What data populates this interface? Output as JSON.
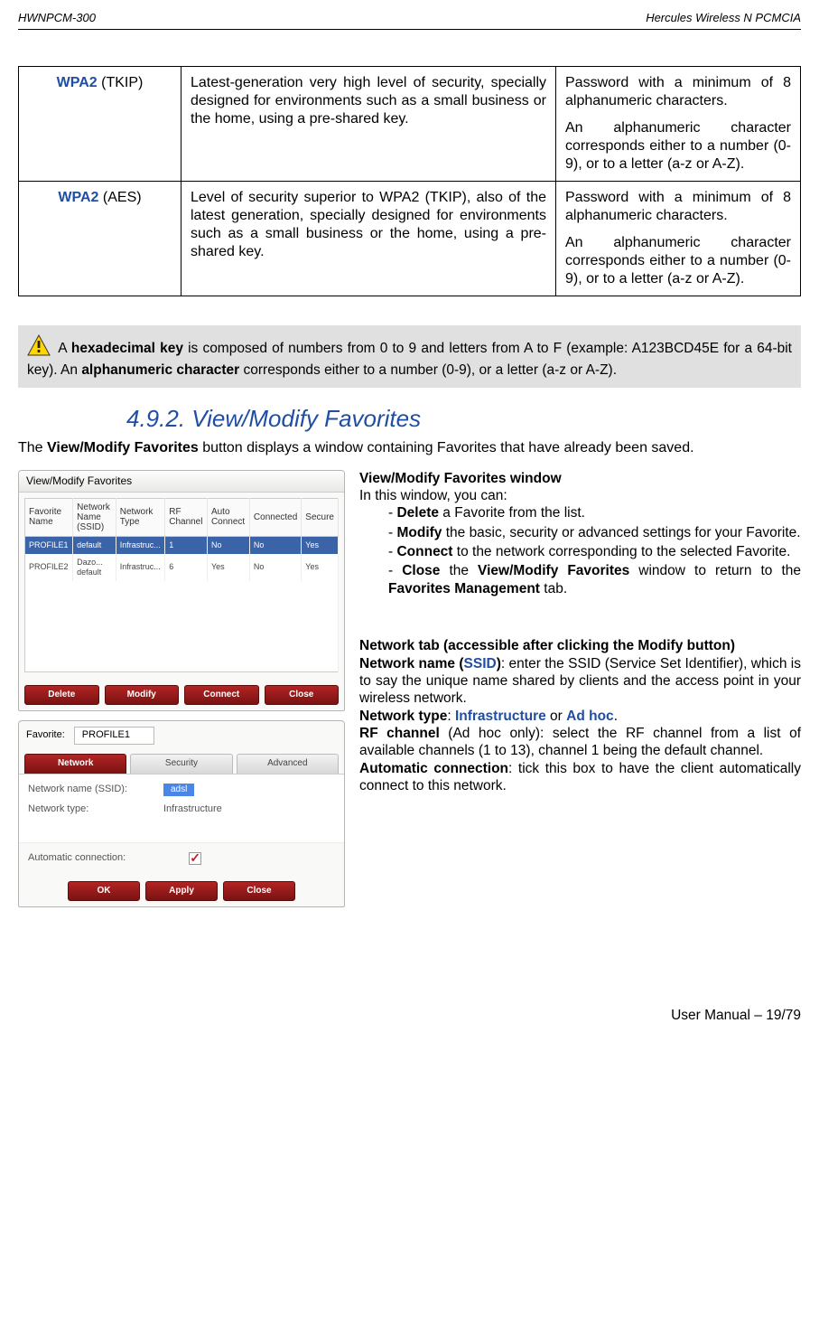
{
  "header": {
    "left": "HWNPCM-300",
    "right": "Hercules Wireless N PCMCIA"
  },
  "table": {
    "rows": [
      {
        "term": "WPA2",
        "paren": " (TKIP)",
        "desc": "Latest-generation very high level of security, specially designed for environments such as a small business or the home, using a pre-shared key.",
        "req1": "Password with a minimum of 8 alphanumeric characters.",
        "req2": "An alphanumeric character corresponds either to a number (0-9), or to a letter (a-z or A-Z)."
      },
      {
        "term": "WPA2",
        "paren": " (AES)",
        "desc": "Level of security superior to WPA2 (TKIP), also of the latest generation, specially designed for environments such as a small business or the home, using a pre-shared key.",
        "req1": "Password with a minimum of 8 alphanumeric characters.",
        "req2": "An alphanumeric character corresponds either to a number (0-9), or to a letter (a-z or A-Z)."
      }
    ]
  },
  "callout": {
    "t1": " A ",
    "b1": "hexadecimal key",
    "t2": " is composed of numbers from 0 to 9 and letters from A to F (example: A123BCD45E for a 64-bit key).  An ",
    "b2": "alphanumeric character",
    "t3": " corresponds either to a number (0-9), or a letter (a-z or A-Z)."
  },
  "section_heading": "4.9.2. View/Modify Favorites",
  "intro": {
    "t1": "The ",
    "b1": "View/Modify Favorites",
    "t2": " button displays a window containing Favorites that have already been saved."
  },
  "right": {
    "top": {
      "heading": "View/Modify Favorites window",
      "lead": "In this window, you can:",
      "items": [
        {
          "b": "Delete",
          "rest": " a Favorite from the list."
        },
        {
          "b": "Modify",
          "rest": " the basic, security or advanced settings for your Favorite."
        },
        {
          "b": "Connect",
          "rest": " to the network corresponding to the selected Favorite."
        },
        {
          "b": "Close",
          "rest_a": " the ",
          "b2": "View/Modify Favorites",
          "rest_b": " window to return to the ",
          "b3": "Favorites Management",
          "rest_c": " tab."
        }
      ]
    },
    "bottom": {
      "h1": "Network tab (accessible after clicking the Modify button)",
      "l2a": "Network name (",
      "l2b": "SSID",
      "l2c": ")",
      "l2d": ": enter the SSID (Service Set Identifier), which is to say the unique name shared by clients and the access point in your wireless network.",
      "l3a": "Network type",
      "l3b": ": ",
      "l3c": "Infrastructure",
      "l3d": " or ",
      "l3e": "Ad hoc",
      "l3f": ".",
      "l4a": "RF channel",
      "l4b": " (Ad hoc only): select the RF channel from a list of available channels (1 to 13), channel 1 being the default channel.",
      "l5a": "Automatic connection",
      "l5b": ": tick this box to have the client automatically connect to this network."
    }
  },
  "panel1": {
    "title": "View/Modify Favorites",
    "cols": [
      "Favorite Name",
      "Network Name (SSID)",
      "Network Type",
      "RF Channel",
      "Auto Connect",
      "Connected",
      "Secure"
    ],
    "row1": [
      "PROFILE1",
      "default",
      "Infrastruc...",
      "1",
      "No",
      "No",
      "Yes"
    ],
    "row2": [
      "PROFILE2",
      "Dazo... default",
      "Infrastruc...",
      "6",
      "Yes",
      "No",
      "Yes"
    ],
    "btns": [
      "Delete",
      "Modify",
      "Connect",
      "Close"
    ]
  },
  "panel2": {
    "label": "Favorite:",
    "value": "PROFILE1",
    "tabs": [
      "Network",
      "Security",
      "Advanced"
    ],
    "form": {
      "r1_label": "Network name (SSID):",
      "r1_val": "adsl",
      "r2_label": "Network type:",
      "r2_val": "Infrastructure"
    },
    "auto_label": "Automatic connection:",
    "btns": [
      "OK",
      "Apply",
      "Close"
    ]
  },
  "footer": "User Manual – 19/79"
}
